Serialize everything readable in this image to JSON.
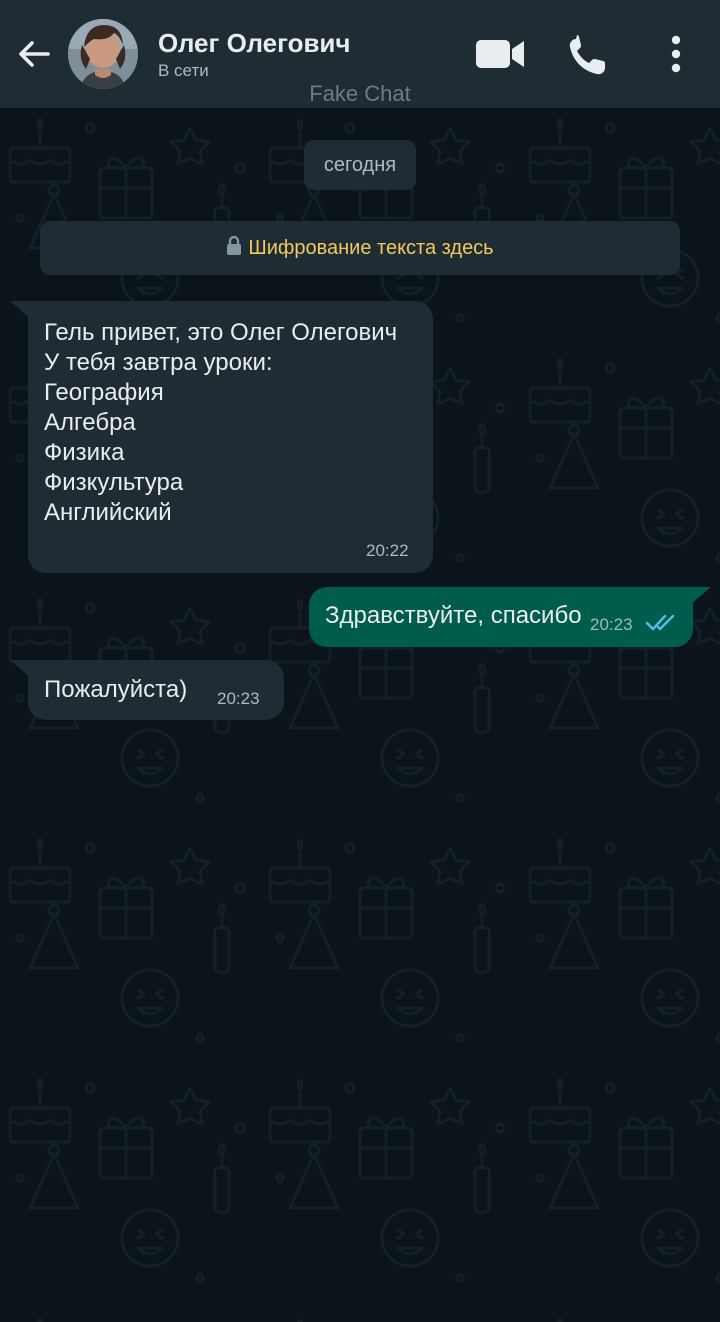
{
  "header": {
    "contact_name": "Олег Олегович",
    "status": "В сети",
    "watermark": "Fake Chat",
    "icons": [
      "back-arrow-icon",
      "video-call-icon",
      "phone-call-icon",
      "more-vertical-icon"
    ]
  },
  "chat": {
    "date_chip": "сегодня",
    "encryption_notice": "Шифрование текста здесь",
    "messages": [
      {
        "direction": "incoming",
        "text": "Гель привет, это Олег Олегович\nУ тебя завтра уроки:\nГеография\nАлгебра\nФизика\nФизкультура\nАнглийский",
        "time": "20:22"
      },
      {
        "direction": "outgoing",
        "text": "Здравствуйте, спасибо",
        "time": "20:23",
        "status": "read"
      },
      {
        "direction": "incoming",
        "text": "Пожалуйста)",
        "time": "20:23"
      }
    ]
  },
  "colors": {
    "header_bg": "#1f2c34",
    "chat_bg": "#0b141a",
    "incoming_bubble": "#1f2c34",
    "outgoing_bubble": "#005c4b",
    "encryption_text": "#f1c95f",
    "read_ticks": "#53bdeb"
  }
}
